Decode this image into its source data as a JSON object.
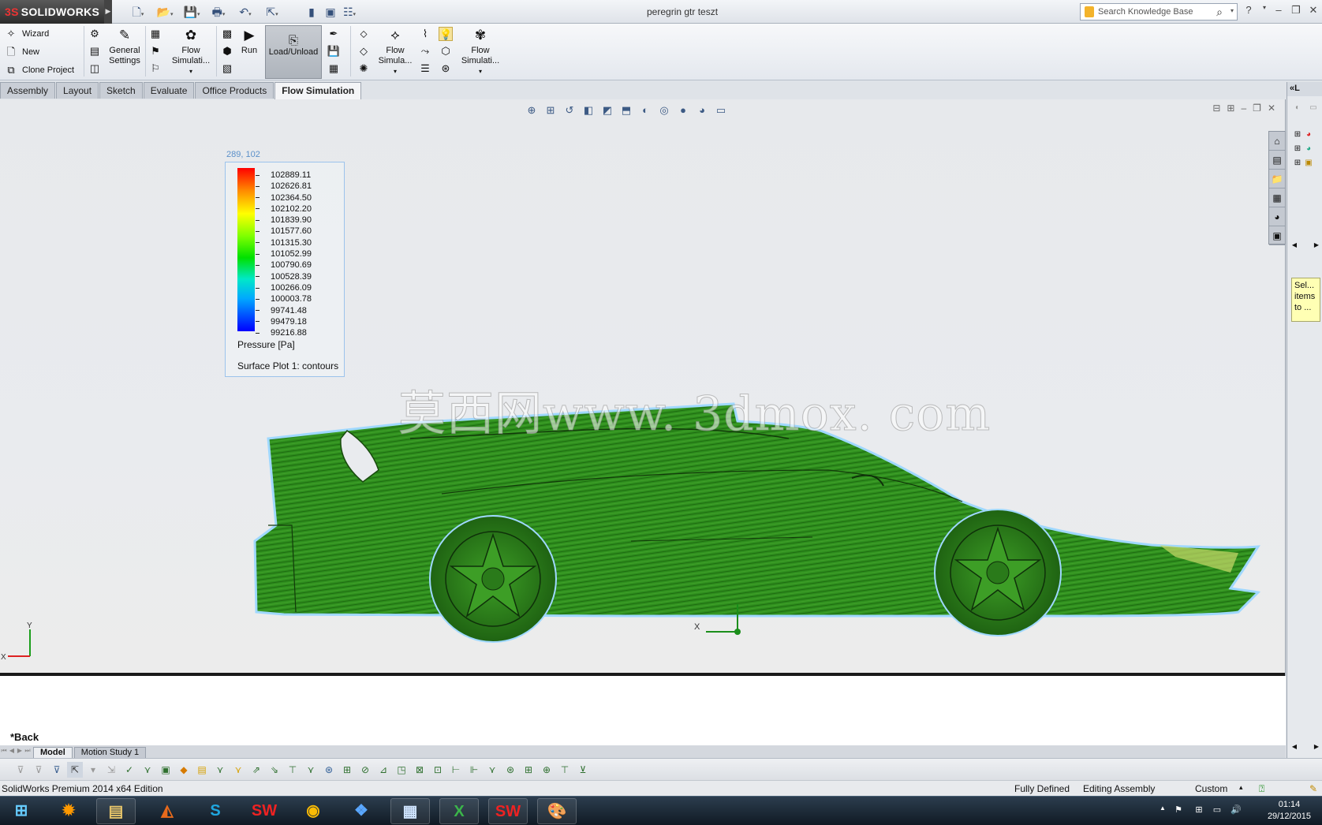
{
  "app": {
    "logo_text": "SOLIDWORKS",
    "document_title": "peregrin gtr teszt",
    "search_placeholder": "Search Knowledge Base"
  },
  "ribbon": {
    "wizard": "Wizard",
    "new": "New",
    "clone_project": "Clone Project",
    "general_settings": "General Settings",
    "flow_sim_1": "Flow Simulati...",
    "run": "Run",
    "load_unload": "Load/Unload",
    "flow_sim_2": "Flow Simula...",
    "flow_sim_3": "Flow Simulati..."
  },
  "command_tabs": [
    "Assembly",
    "Layout",
    "Sketch",
    "Evaluate",
    "Office Products",
    "Flow Simulation"
  ],
  "active_command_tab": "Flow Simulation",
  "legend": {
    "position_readout": "289, 102",
    "values": [
      "102889.11",
      "102626.81",
      "102364.50",
      "102102.20",
      "101839.90",
      "101577.60",
      "101315.30",
      "101052.99",
      "100790.69",
      "100528.39",
      "100266.09",
      "100003.78",
      "99741.48",
      "99479.18",
      "99216.88"
    ],
    "quantity": "Pressure [Pa]",
    "plot_name": "Surface Plot 1: contours",
    "colors": [
      "#ff0000",
      "#ffff00",
      "#00e000",
      "#00a8ff",
      "#0000ff"
    ]
  },
  "watermark": "莫西网www. 3dmox. com",
  "triad": {
    "x_label": "X",
    "y_label": "Y"
  },
  "view_label": "*Back",
  "model_tabs": [
    "Model",
    "Motion Study 1"
  ],
  "status": {
    "edition": "SolidWorks Premium 2014 x64 Edition",
    "defined": "Fully Defined",
    "mode": "Editing Assembly",
    "units": "Custom"
  },
  "taskpane": {
    "header": "«L",
    "note": "Sel... items to ..."
  },
  "taskbar": {
    "time": "01:14",
    "date": "29/12/2015"
  }
}
